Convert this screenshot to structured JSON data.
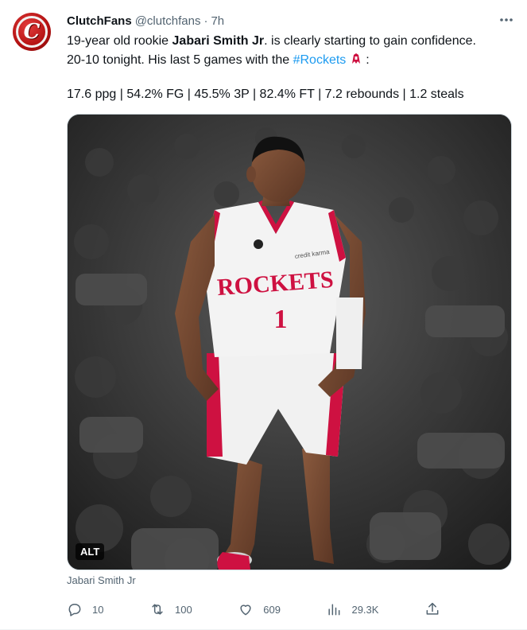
{
  "author": {
    "name": "ClutchFans",
    "handle": "@clutchfans",
    "separator": "·",
    "time": "7h",
    "avatar_letter": "C"
  },
  "tweet": {
    "line1_prefix": "19-year old rookie ",
    "line1_bold": "Jabari Smith Jr",
    "line1_suffix": ". is clearly starting to gain confidence.",
    "line2_prefix": "20-10 tonight. His last 5 games with the ",
    "hashtag": "#Rockets",
    "line2_suffix": " :",
    "stats_line": "17.6 ppg | 54.2% FG | 45.5% 3P | 82.4% FT | 7.2 rebounds | 1.2 steals"
  },
  "media": {
    "alt_label": "ALT",
    "jersey_text": "ROCKETS",
    "jersey_number": "1",
    "sponsor_text": "credit karma",
    "caption": "Jabari Smith Jr"
  },
  "actions": {
    "replies": "10",
    "retweets": "100",
    "likes": "609",
    "views": "29.3K"
  },
  "colors": {
    "hashtag": "#1d9bf0",
    "muted": "#536471",
    "rockets_red": "#ce1141"
  },
  "icons": [
    "more-icon",
    "rockets-logo-icon",
    "reply-icon",
    "retweet-icon",
    "like-icon",
    "views-icon",
    "share-icon"
  ]
}
